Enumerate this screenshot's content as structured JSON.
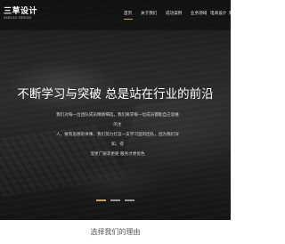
{
  "header": {
    "logo_text": "三草设计",
    "logo_subtext": "SANCAO DESIGN",
    "nav": [
      {
        "label": "首页"
      },
      {
        "label": "关于我们"
      },
      {
        "label": "成功案例"
      },
      {
        "label": "业务领域"
      },
      {
        "label": "电商设计"
      },
      {
        "label": "新闻"
      }
    ],
    "active_index": 0
  },
  "hero": {
    "headline": "不断学习与突破 总是站在行业的前沿",
    "description_lines": [
      "我们对每一位团队成员精挑细选，我们要求每一位成员都能自己思维的主",
      "人，要有思想的体事，我们努力打造一支学习型的团队，因为我们深知，得",
      "宠更广跟求更距 服务才更优色"
    ],
    "slides": 3,
    "active_slide": 0
  },
  "section": {
    "title": "选择我们的理由"
  },
  "colors": {
    "accent": "#c9a063",
    "hero_bg": "#222222",
    "section_title": "#555555"
  }
}
